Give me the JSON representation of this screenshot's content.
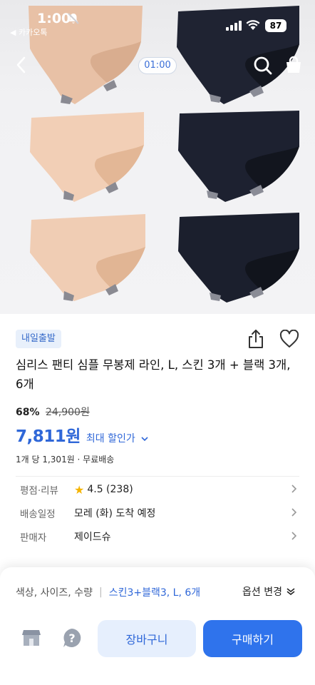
{
  "status_bar": {
    "time": "1:00",
    "back_app": "◀ 카카오톡",
    "battery": "87"
  },
  "media": {
    "timer": "01:00"
  },
  "product": {
    "badge": "내일출발",
    "title": "심리스 팬티 심플 무봉제 라인, L, 스킨 3개 + 블랙 3개, 6개",
    "discount_rate": "68%",
    "original_price": "24,900원",
    "price": "7,811원",
    "max_discount_label": "최대 할인가",
    "unit_info": "1개 당 1,301원 · 무료배송"
  },
  "details": [
    {
      "label": "평점·리뷰",
      "value": "4.5 (238)"
    },
    {
      "label": "배송일정",
      "value": "모레 (화) 도착 예정"
    },
    {
      "label": "판매자",
      "value": "제이드슈"
    }
  ],
  "bottom_sheet": {
    "option_label": "색상, 사이즈, 수량",
    "option_value": "스킨3+블랙3, L, 6개",
    "option_change": "옵션 변경",
    "cart_button": "장바구니",
    "buy_button": "구매하기"
  },
  "colors": {
    "accent": "#2f73ec",
    "price_blue": "#2f67d8",
    "skin": "#f0cdb4",
    "black": "#1d2130"
  },
  "icons": [
    "bell-off-icon",
    "signal-icon",
    "wifi-icon",
    "back-icon",
    "search-icon",
    "shopping-bag-icon",
    "share-icon",
    "heart-icon",
    "star-icon",
    "chevron-right-icon",
    "chevron-down-icon",
    "store-icon",
    "help-icon"
  ]
}
